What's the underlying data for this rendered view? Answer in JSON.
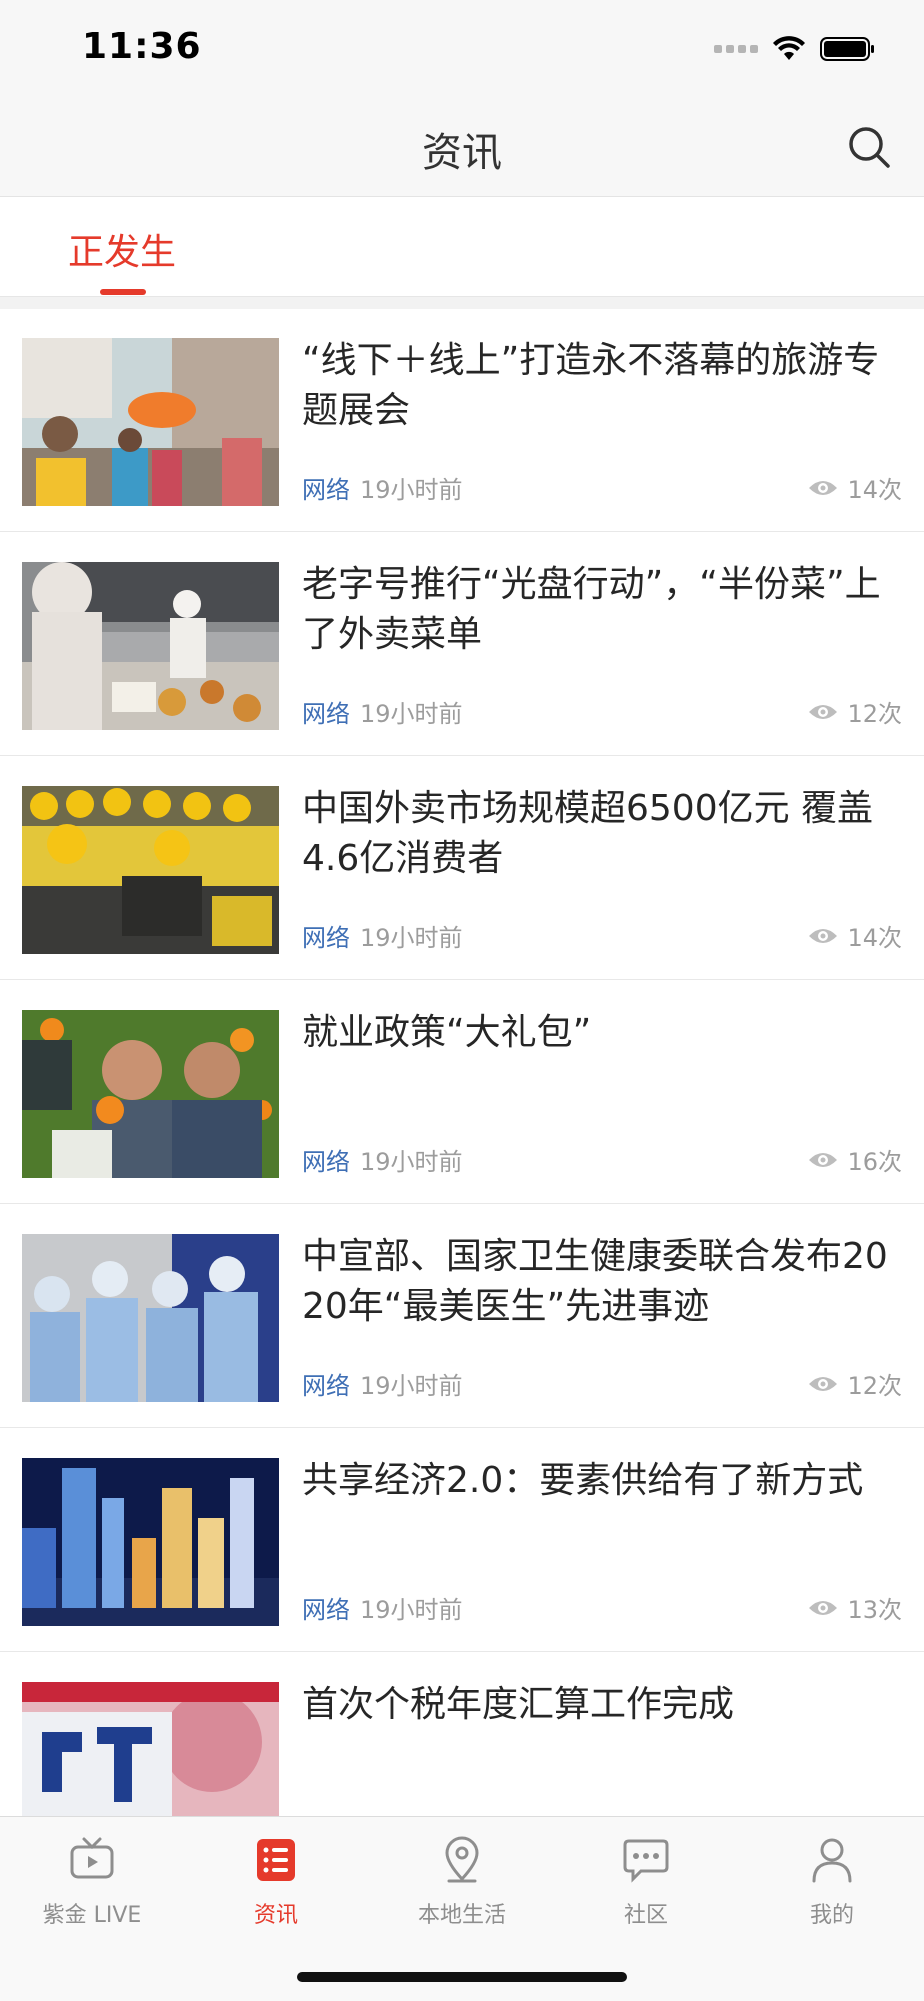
{
  "status_bar": {
    "time": "11:36"
  },
  "header": {
    "title": "资讯",
    "search_icon": "search-icon"
  },
  "category_tabs": [
    {
      "label": "正发生",
      "active": true
    }
  ],
  "news": [
    {
      "title": "“线下＋线上”打造永不落幕的旅游专题展会",
      "source": "网络",
      "time": "19小时前",
      "views": "14次",
      "thumbnail": "tourism-exhibition-photo"
    },
    {
      "title": "老字号推行“光盘行动”，“半份菜”上了外卖菜单",
      "source": "网络",
      "time": "19小时前",
      "views": "12次",
      "thumbnail": "restaurant-kitchen-photo"
    },
    {
      "title": "中国外卖市场规模超6500亿元 覆盖4.6亿消费者",
      "source": "网络",
      "time": "19小时前",
      "views": "14次",
      "thumbnail": "delivery-riders-photo"
    },
    {
      "title": "就业政策“大礼包”",
      "source": "网络",
      "time": "19小时前",
      "views": "16次",
      "thumbnail": "orange-orchard-photo"
    },
    {
      "title": "中宣部、国家卫生健康委联合发布2020年“最美医生”先进事迹",
      "source": "网络",
      "time": "19小时前",
      "views": "12次",
      "thumbnail": "medical-workers-photo"
    },
    {
      "title": "共享经济2.0：要素供给有了新方式",
      "source": "网络",
      "time": "19小时前",
      "views": "13次",
      "thumbnail": "city-skyline-photo"
    },
    {
      "title": "首次个税年度汇算工作完成",
      "source": "",
      "time": "",
      "views": "",
      "thumbnail": "tax-sign-photo"
    }
  ],
  "bottom_tabs": [
    {
      "label": "紫金 LIVE",
      "icon": "tv-icon",
      "active": false
    },
    {
      "label": "资讯",
      "icon": "news-list-icon",
      "active": true
    },
    {
      "label": "本地生活",
      "icon": "location-pin-icon",
      "active": false
    },
    {
      "label": "社区",
      "icon": "chat-bubble-icon",
      "active": false
    },
    {
      "label": "我的",
      "icon": "person-icon",
      "active": false
    }
  ],
  "colors": {
    "accent": "#e53a2b",
    "source_link": "#3f6fb5",
    "meta_gray": "#9c9c9c"
  }
}
